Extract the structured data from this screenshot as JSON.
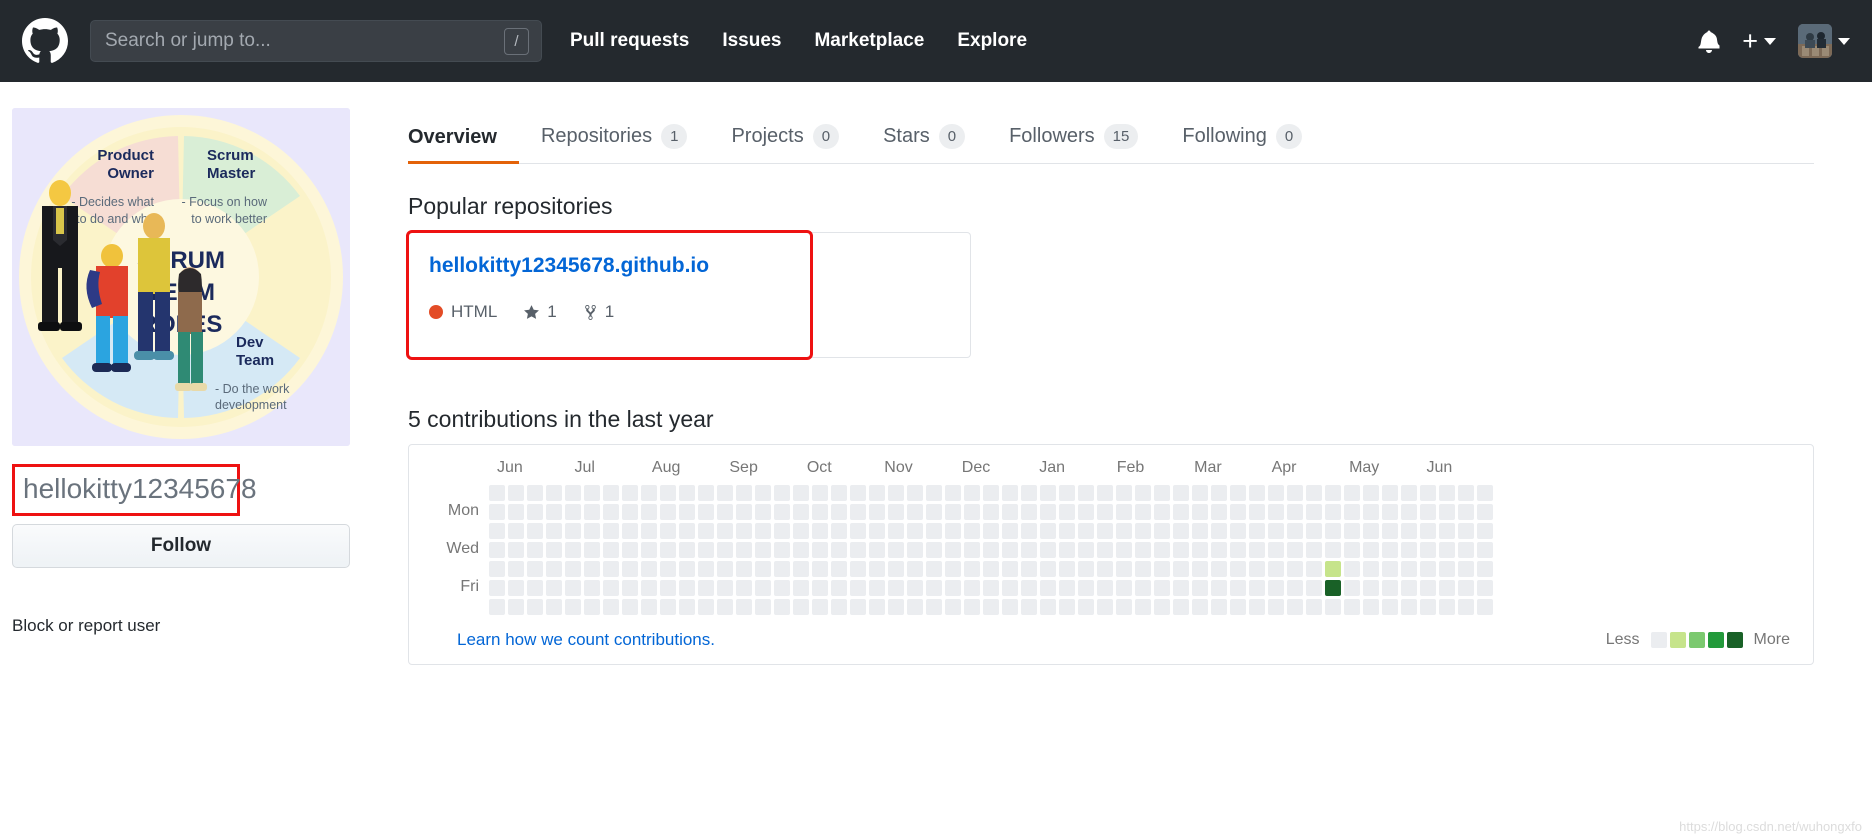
{
  "header": {
    "logo_icon": "github-mark-icon",
    "search": {
      "placeholder": "Search or jump to...",
      "value": "",
      "shortcut_key": "/"
    },
    "nav": [
      {
        "label": "Pull requests",
        "name": "pull-requests"
      },
      {
        "label": "Issues",
        "name": "issues"
      },
      {
        "label": "Marketplace",
        "name": "marketplace"
      },
      {
        "label": "Explore",
        "name": "explore"
      }
    ],
    "notifications_icon": "bell-icon",
    "create_new_icon": "plus-icon",
    "avatar_icon": "user-avatar"
  },
  "sidebar": {
    "avatar_image": {
      "alt": "scrum-team-roles-infographic",
      "title_lines": [
        "SCRUM",
        "TEAM",
        "ROLES"
      ],
      "segments": [
        {
          "title": "Product\nOwner",
          "desc": "- Decides what\nto do and why"
        },
        {
          "title": "Scrum\nMaster",
          "desc": "- Focus on how\nto work better"
        },
        {
          "title": "Dev\nTeam",
          "desc": "- Do the work\ndevelopment"
        }
      ]
    },
    "username": "hellokitty12345678",
    "follow_label": "Follow",
    "block_report_label": "Block or report user"
  },
  "main": {
    "tabs": [
      {
        "label": "Overview",
        "count": null,
        "active": true
      },
      {
        "label": "Repositories",
        "count": "1",
        "active": false
      },
      {
        "label": "Projects",
        "count": "0",
        "active": false
      },
      {
        "label": "Stars",
        "count": "0",
        "active": false
      },
      {
        "label": "Followers",
        "count": "15",
        "active": false
      },
      {
        "label": "Following",
        "count": "0",
        "active": false
      }
    ],
    "popular_repositories": {
      "heading": "Popular repositories",
      "repos": [
        {
          "name": "hellokitty12345678.github.io",
          "language": "HTML",
          "language_color": "#e34c26",
          "stars": "1",
          "forks": "1",
          "highlighted": true
        }
      ]
    },
    "contributions": {
      "heading": "5 contributions in the last year",
      "months": [
        "Jun",
        "Jul",
        "Aug",
        "Sep",
        "Oct",
        "Nov",
        "Dec",
        "Jan",
        "Feb",
        "Mar",
        "Apr",
        "May",
        "Jun"
      ],
      "weekdays": [
        "Mon",
        "Wed",
        "Fri"
      ],
      "learn_link_label": "Learn how we count contributions.",
      "legend": {
        "less_label": "Less",
        "more_label": "More",
        "colors": [
          "#ebedf0",
          "#c6e48b",
          "#7bc96f",
          "#239a3b",
          "#196127"
        ]
      },
      "active_cells": [
        {
          "week": 44,
          "day": 4,
          "color": "#c6e48b"
        },
        {
          "week": 44,
          "day": 5,
          "color": "#196127"
        }
      ],
      "empty_color": "#ebedf0",
      "weeks": 53,
      "days_per_week": 7
    }
  },
  "watermark": "https://blog.csdn.net/wuhongxfo"
}
